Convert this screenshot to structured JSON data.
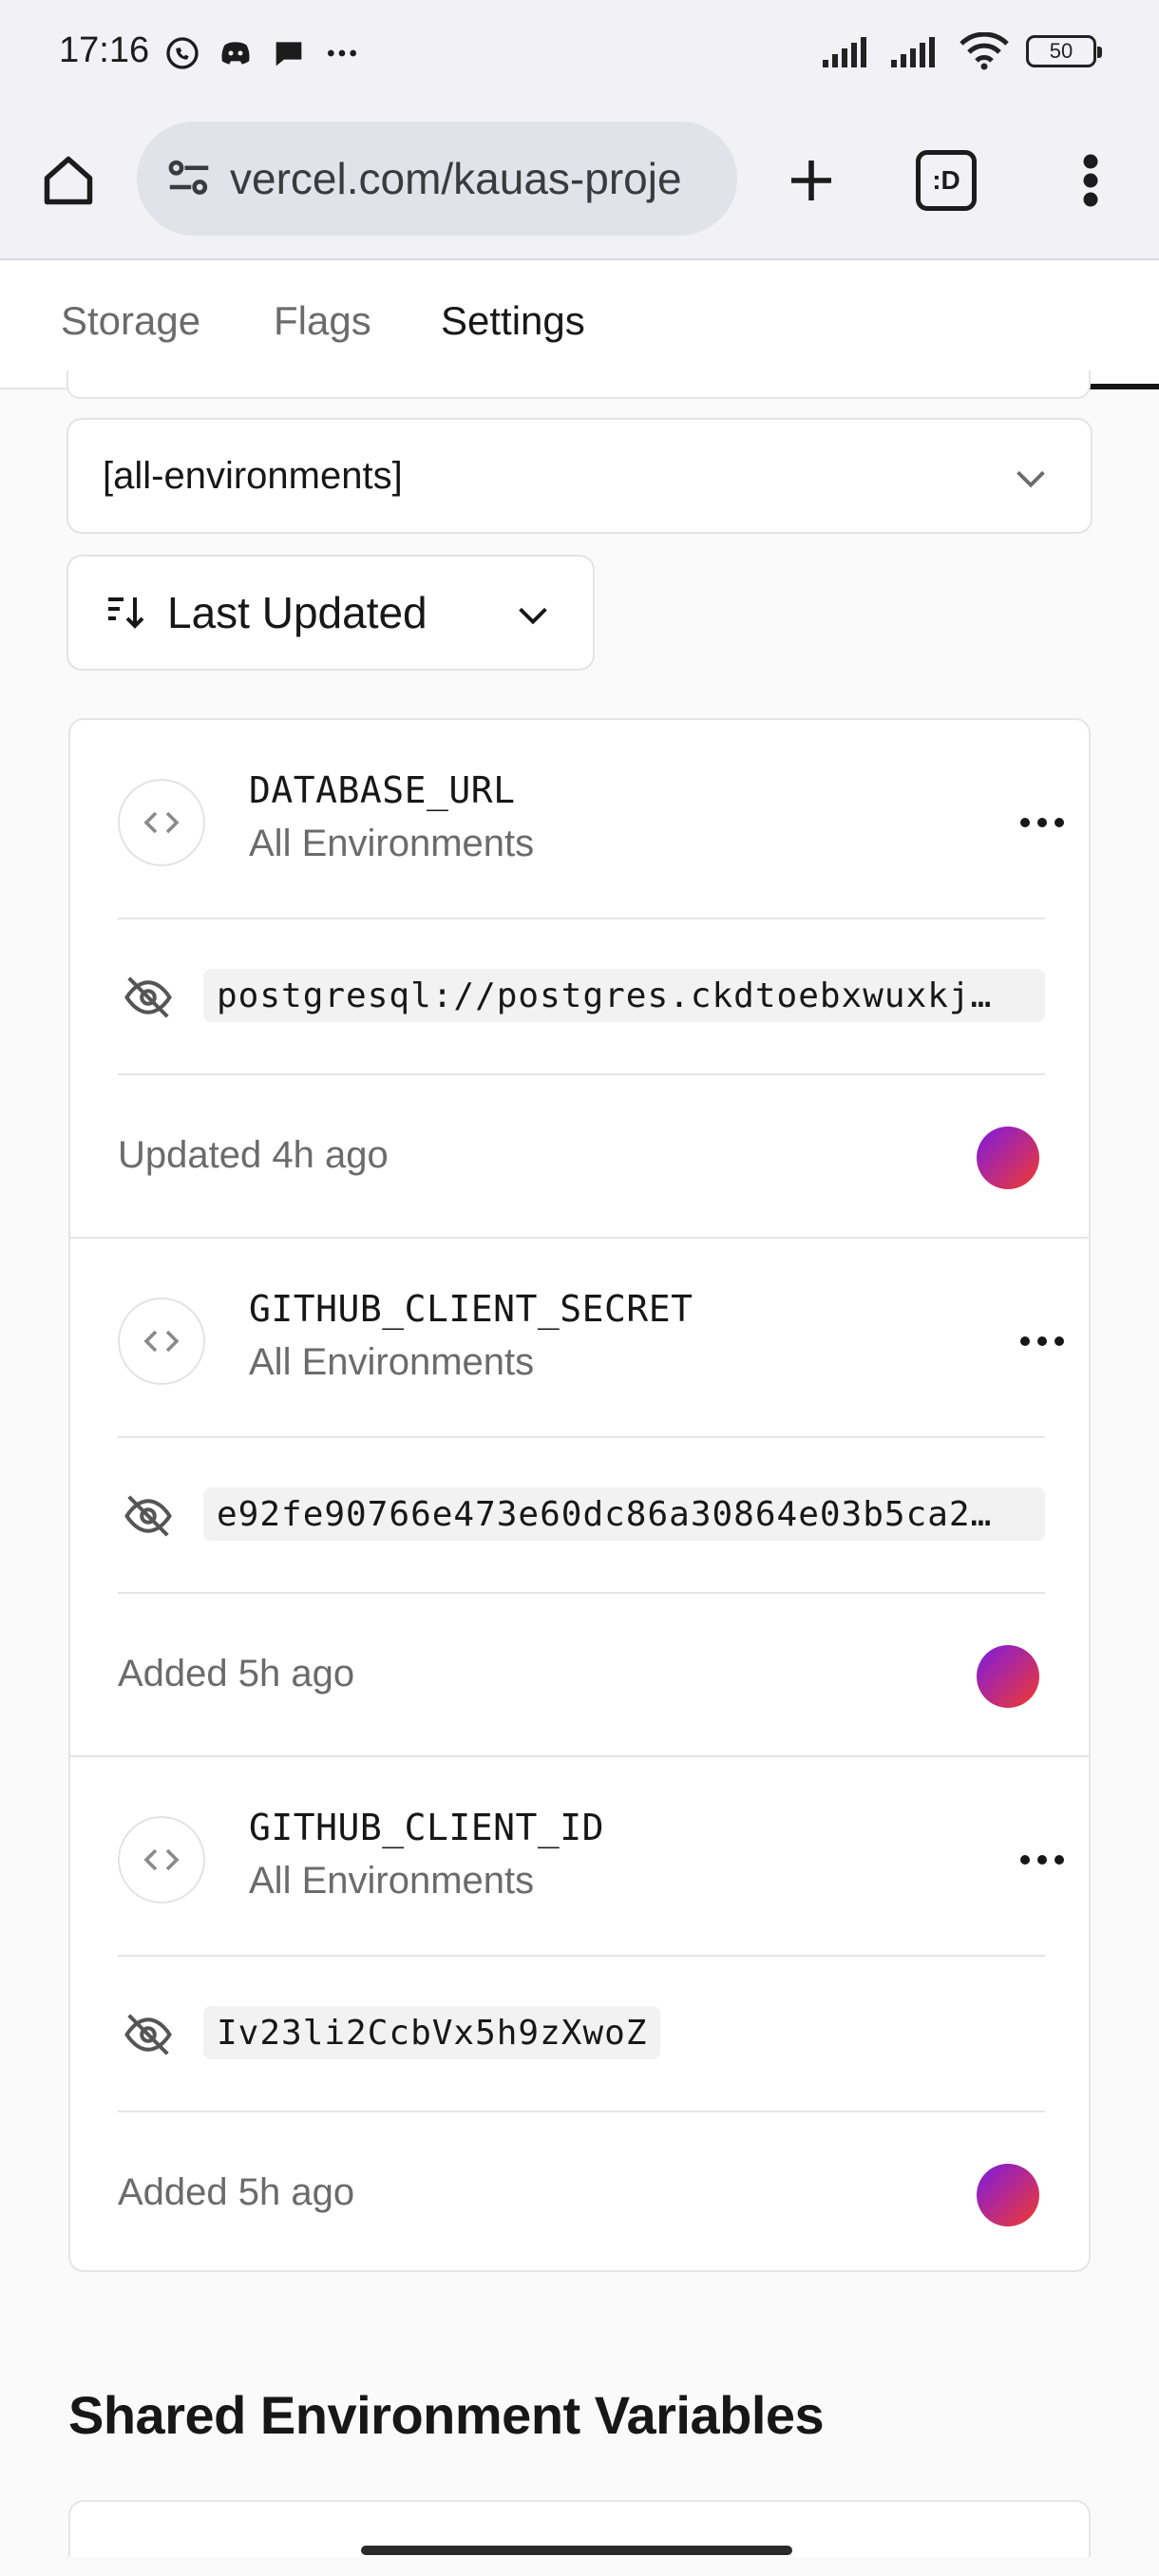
{
  "status_bar": {
    "time": "17:16",
    "battery": "50",
    "app_icons": [
      "whatsapp-icon",
      "discord-icon",
      "chat-icon",
      "more-notifications-icon"
    ]
  },
  "browser": {
    "url": "vercel.com/kauas-proje",
    "tabs_label": ":D"
  },
  "nav": {
    "tabs": [
      {
        "label": "Storage"
      },
      {
        "label": "Flags"
      },
      {
        "label": "Settings"
      }
    ]
  },
  "filters": {
    "environment_value": "[all-environments]",
    "sort_label": "Last Updated"
  },
  "env_vars": [
    {
      "name": "DATABASE_URL",
      "environments": "All Environments",
      "value": "postgresql://postgres.ckdtoebxwuxkj…",
      "updated": "Updated 4h ago"
    },
    {
      "name": "GITHUB_CLIENT_SECRET",
      "environments": "All Environments",
      "value": "e92fe90766e473e60dc86a30864e03b5ca2…",
      "updated": "Added 5h ago"
    },
    {
      "name": "GITHUB_CLIENT_ID",
      "environments": "All Environments",
      "value": "Iv23li2CcbVx5h9zXwoZ",
      "updated": "Added 5h ago"
    }
  ],
  "shared_section": {
    "title": "Shared Environment Variables"
  },
  "colors": {
    "accent": "#171717",
    "muted_text": "#6b6b6b",
    "avatar_gradient_start": "#7a1ae0",
    "avatar_gradient_end": "#f03a2a"
  }
}
